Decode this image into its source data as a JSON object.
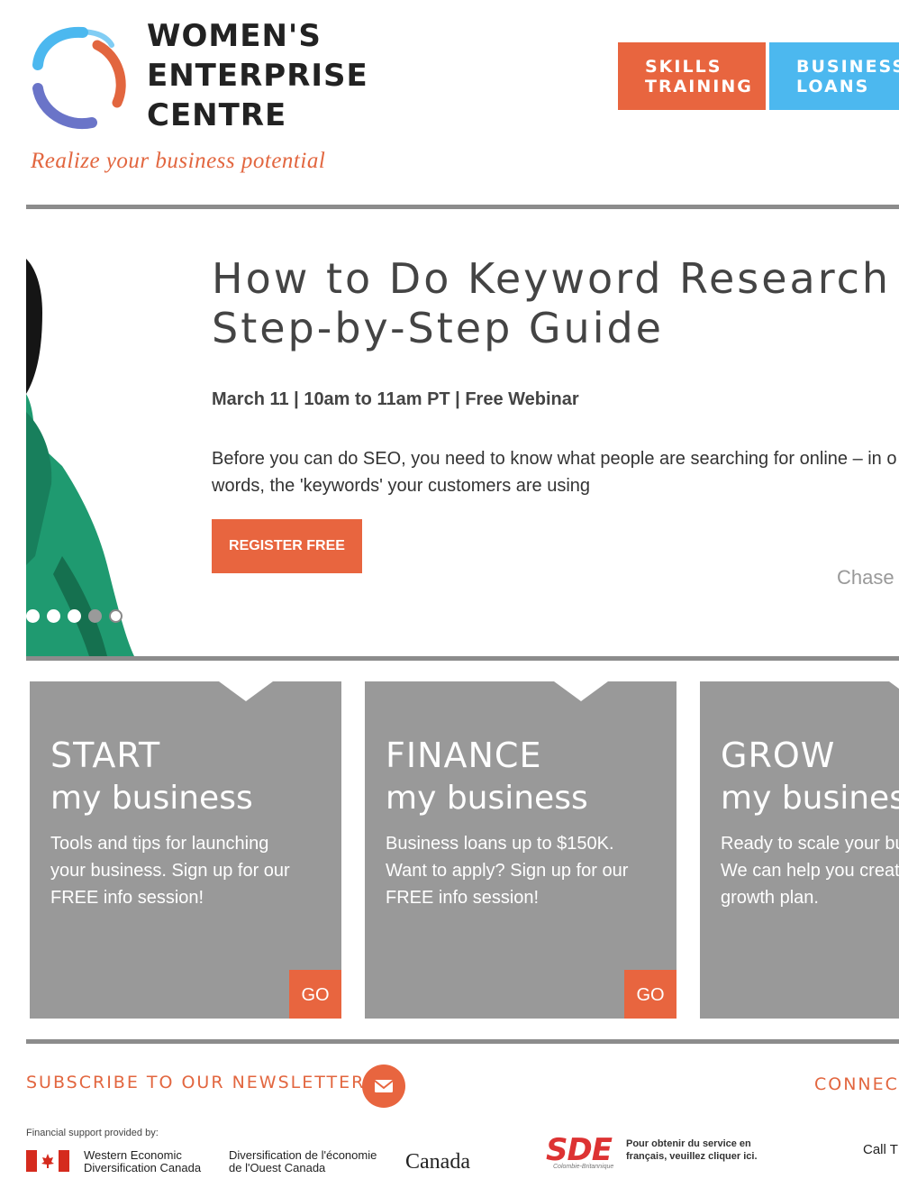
{
  "header": {
    "logo_line1": "WOMEN'S",
    "logo_line2": "ENTERPRISE",
    "logo_line3": "CENTRE",
    "tagline": "Realize your business potential",
    "buttons": [
      {
        "line1": "SKILLS",
        "line2": "TRAINING"
      },
      {
        "line1": "BUSINESS",
        "line2": "LOANS"
      }
    ]
  },
  "hero": {
    "title": "How to Do Keyword Research fo\nStep-by-Step Guide",
    "date_line": "March 11 | 10am to 11am PT | Free Webinar",
    "description": "Before you can do SEO, you need to know what people are searching for online – in o\nwords, the 'keywords' your customers are using",
    "register_label": "REGISTER FREE",
    "next_slide_peek": "Chase Y",
    "slide_count": 5,
    "active_slide_index": 3
  },
  "cards": [
    {
      "heading": "START",
      "subheading": "my business",
      "text": "Tools and tips for launching\nyour business. Sign up for our\nFREE info session!",
      "go_label": "GO"
    },
    {
      "heading": "FINANCE",
      "subheading": "my business",
      "text": "Business loans up to $150K.\nWant to apply? Sign up for our\nFREE info session!",
      "go_label": "GO"
    },
    {
      "heading": "GROW",
      "subheading": "my business",
      "text": "Ready to scale your bu\nWe can help you creat\ngrowth plan."
    }
  ],
  "footer": {
    "subscribe_label": "SUBSCRIBE TO OUR NEWSLETTER!",
    "connect_label": "CONNEC",
    "financial_support": "Financial support provided by:",
    "wed_en": "Western Economic\nDiversification Canada",
    "wed_fr": "Diversification de l'économie\nde l'Ouest Canada",
    "canada_wordmark": "Canada",
    "sde_logo": "SDE",
    "sde_sub": "Colombie-Britannique",
    "sde_text": "Pour obtenir du service en\nfrançais, veuillez cliquer ici.",
    "call_label": "Call T"
  },
  "colors": {
    "accent_orange": "#e8653f",
    "accent_blue": "#4cb8ef",
    "card_gray": "#999999",
    "rule_gray": "#8c8c8c"
  }
}
